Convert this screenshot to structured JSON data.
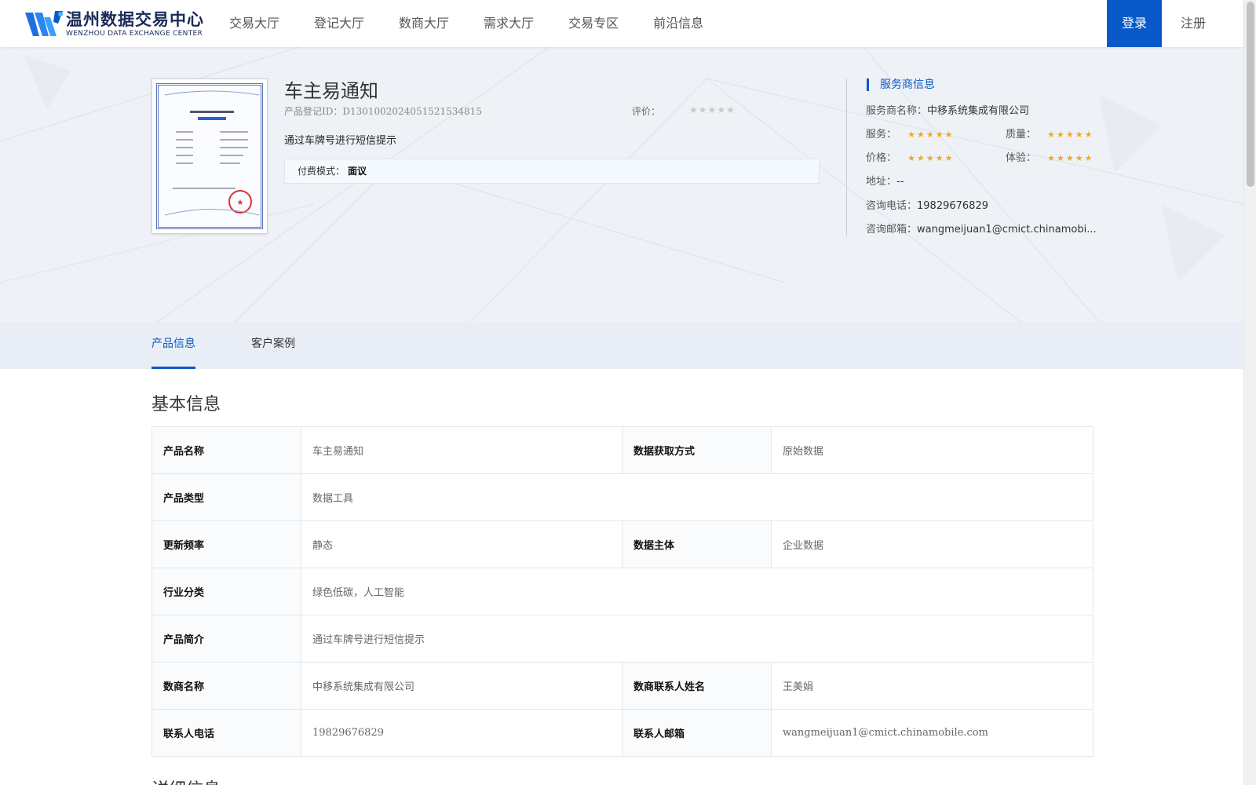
{
  "header": {
    "logo_cn": "温州数据交易中心",
    "logo_en": "WENZHOU DATA EXCHANGE CENTER",
    "nav": [
      "交易大厅",
      "登记大厅",
      "数商大厅",
      "需求大厅",
      "交易专区",
      "前沿信息"
    ],
    "login": "登录",
    "register": "注册",
    "accent_color": "#0a59c9"
  },
  "product": {
    "title": "车主易通知",
    "id_text": "产品登记ID：D130100202405152153481​5",
    "rating_label": "评价：",
    "rating_value": 0,
    "description": "通过车牌号进行短信提示",
    "pay_label": "付费模式：",
    "pay_value": "面议"
  },
  "provider": {
    "title": "服务商信息",
    "name_label": "服务商名称：",
    "name": "中移系统集成有限公司",
    "service_label": "服务：",
    "service_rating": 5,
    "quality_label": "质量：",
    "quality_rating": 5,
    "price_label": "价格：",
    "price_rating": 5,
    "experience_label": "体验：",
    "experience_rating": 5,
    "address_label": "地址：",
    "address": "--",
    "phone_label": "咨询电话：",
    "phone": "19829676829",
    "email_label": "咨询邮箱：",
    "email": "wangmeijuan1@cmict.chinamobi..."
  },
  "tabs": [
    "产品信息",
    "客户案例"
  ],
  "basic_info": {
    "title": "基本信息",
    "rows": [
      {
        "k1": "产品名称",
        "v1": "车主易通知",
        "k2": "数据获取方式",
        "v2": "原始数据"
      },
      {
        "k1": "产品类型",
        "v1": "数据工具"
      },
      {
        "k1": "更新频率",
        "v1": "静态",
        "k2": "数据主体",
        "v2": "企业数据"
      },
      {
        "k1": "行业分类",
        "v1": "绿色低碳，人工智能"
      },
      {
        "k1": "产品简介",
        "v1": "通过车牌号进行短信提示"
      },
      {
        "k1": "数商名称",
        "v1": "中移系统集成有限公司",
        "k2": "数商联系人姓名",
        "v2": "王美娟"
      },
      {
        "k1": "联系人电话",
        "v1": "19829676829",
        "k2": "联系人邮箱",
        "v2": "wangmeijuan1@cmict.chinamobile.com"
      }
    ]
  },
  "next_section_title": "详细信息"
}
